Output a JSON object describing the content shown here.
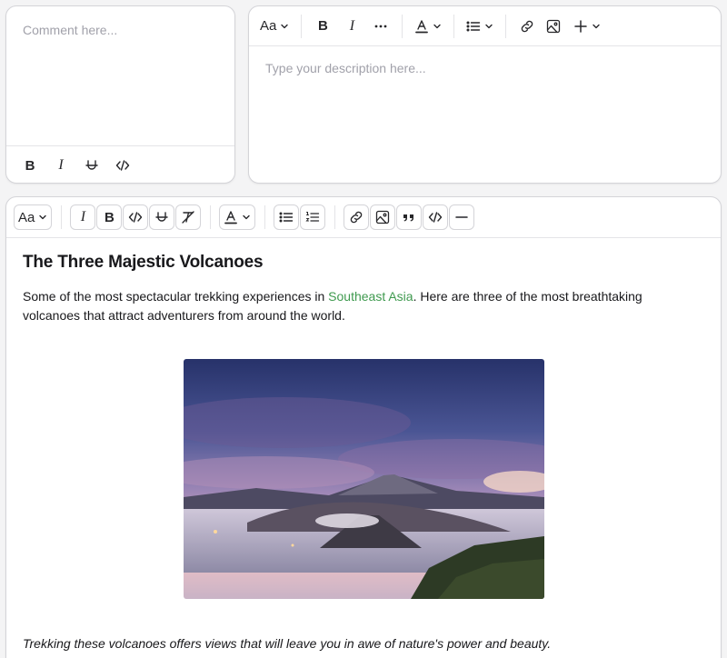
{
  "comment": {
    "placeholder": "Comment here...",
    "toolbar": [
      "bold-button",
      "italic-button",
      "strikethrough-button",
      "code-button"
    ]
  },
  "description": {
    "placeholder": "Type your description here...",
    "font_label": "Aa"
  },
  "editor": {
    "font_label": "Aa",
    "title": "The Three Majestic Volcanoes",
    "para_before_link": "Some of the most spectacular trekking experiences in ",
    "link_text": "Southeast Asia",
    "para_after_link": ". Here are three of the most breathtaking volcanoes that attract adventurers from around the world.",
    "caption": "Trekking these volcanoes offers views that will leave you in awe of nature's power and beauty."
  },
  "colors": {
    "link": "#3f9a4f",
    "border": "#d4d4d8",
    "placeholder": "#a1a1aa"
  }
}
